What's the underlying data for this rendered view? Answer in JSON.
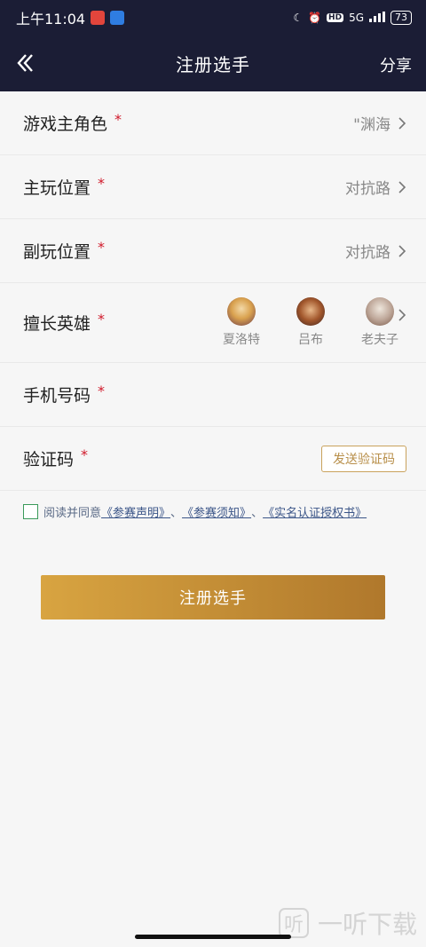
{
  "status_bar": {
    "time": "上午11:04",
    "network": "5G",
    "battery": "73"
  },
  "header": {
    "title": "注册选手",
    "share": "分享"
  },
  "form": {
    "game_role": {
      "label": "游戏主角色",
      "required": "*",
      "value": "\"渊海"
    },
    "main_position": {
      "label": "主玩位置",
      "required": "*",
      "value": "对抗路"
    },
    "secondary_position": {
      "label": "副玩位置",
      "required": "*",
      "value": "对抗路"
    },
    "heroes": {
      "label": "擅长英雄",
      "required": "*",
      "list": [
        {
          "name": "夏洛特"
        },
        {
          "name": "吕布"
        },
        {
          "name": "老夫子"
        }
      ]
    },
    "phone": {
      "label": "手机号码",
      "required": "*"
    },
    "code": {
      "label": "验证码",
      "required": "*",
      "send_button": "发送验证码"
    }
  },
  "agreement": {
    "prefix": "阅读并同意",
    "link1": "《参赛声明》",
    "sep1": "、",
    "link2": "《参赛须知》",
    "sep2": "、",
    "link3": "《实名认证授权书》"
  },
  "submit_label": "注册选手",
  "watermark": {
    "icon_text": "听",
    "text": "一听下载"
  },
  "colors": {
    "header_bg": "#1b1d35",
    "required": "#d0192a",
    "accent": "#c9a25c"
  }
}
